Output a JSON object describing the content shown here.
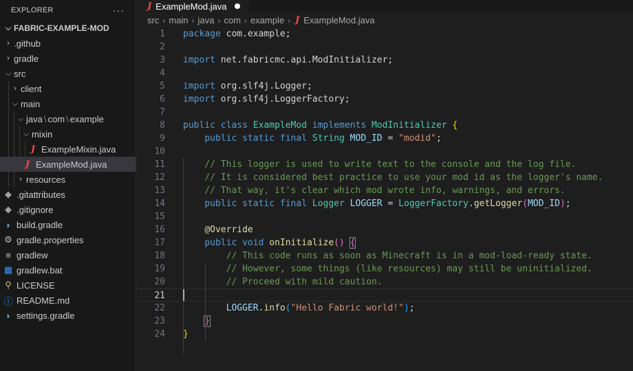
{
  "explorer": {
    "title": "EXPLORER",
    "more": "···",
    "project": "FABRIC-EXAMPLE-MOD",
    "items": [
      {
        "label": ".github"
      },
      {
        "label": "gradle"
      },
      {
        "label": "src"
      },
      {
        "label": "client"
      },
      {
        "label": "main"
      },
      {
        "parts": [
          "java",
          "com",
          "example"
        ]
      },
      {
        "label": "mixin"
      },
      {
        "label": "ExampleMixin.java"
      },
      {
        "label": "ExampleMod.java"
      },
      {
        "label": "resources"
      },
      {
        "label": ".gitattributes"
      },
      {
        "label": ".gitignore"
      },
      {
        "label": "build.gradle"
      },
      {
        "label": "gradle.properties"
      },
      {
        "label": "gradlew"
      },
      {
        "label": "gradlew.bat"
      },
      {
        "label": "LICENSE"
      },
      {
        "label": "README.md"
      },
      {
        "label": "settings.gradle"
      }
    ]
  },
  "tab": {
    "label": "ExampleMod.java",
    "icon": "J"
  },
  "breadcrumb": [
    "src",
    "main",
    "java",
    "com",
    "example",
    "ExampleMod.java"
  ],
  "code": {
    "current_line": 21,
    "tokens": {
      "package": "package",
      "pkg": "com.example;",
      "import": "import",
      "imp1": "net.fabricmc.api.ModInitializer;",
      "imp2": "org.slf4j.Logger;",
      "imp3": "org.slf4j.LoggerFactory;",
      "public": "public",
      "class": "class",
      "classname": "ExampleMod",
      "implements": "implements",
      "iface": "ModInitializer",
      "static": "static",
      "final": "final",
      "String": "String",
      "MOD_ID": "MOD_ID",
      "modid": "\"modid\"",
      "c1": "// This logger is used to write text to the console and the log file.",
      "c2": "// It is considered best practice to use your mod id as the logger's name.",
      "c3": "// That way, it's clear which mod wrote info, warnings, and errors.",
      "Logger": "Logger",
      "LOGGER": "LOGGER",
      "LoggerFactory": "LoggerFactory",
      "getLogger": "getLogger",
      "override": "@Override",
      "void": "void",
      "onInitialize": "onInitialize",
      "c4": "// This code runs as soon as Minecraft is in a mod-load-ready state.",
      "c5": "// However, some things (like resources) may still be uninitialized.",
      "c6": "// Proceed with mild caution.",
      "info": "info",
      "hello": "\"Hello Fabric world!\""
    }
  },
  "colors": {
    "keyword": "#569cd6",
    "type": "#4ec9b0",
    "comment": "#6a9955",
    "string": "#ce9178",
    "function": "#dcdcaa"
  }
}
